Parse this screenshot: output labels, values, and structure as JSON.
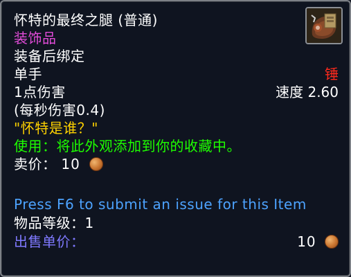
{
  "item": {
    "name": "怀特的最终之腿 (普通)",
    "type": "装饰品",
    "binding": "装备后绑定",
    "slot": "单手",
    "subtype": "锤",
    "damage": "1点伤害",
    "speed": "速度 2.60",
    "dps": "(每秒伤害0.4)",
    "flavor": "\"怀特是谁？\"",
    "use": "使用：将此外观添加到你的收藏中。",
    "sell": {
      "label": "卖价：",
      "amount": "10"
    },
    "press_f6": "Press F6 to submit an issue for this Item",
    "item_level": "物品等级：1",
    "unit_price": {
      "label": "出售单价：",
      "amount": "10"
    }
  },
  "colors": {
    "name": "#ffffff",
    "type": "#e14bd8",
    "white": "#ffffff",
    "red": "#ff2a1c",
    "flavor": "#ffd200",
    "use": "#1eff00",
    "blue": "#4da3ff",
    "coin": "copper-coin-icon"
  },
  "icon": {
    "name": "bag-of-meat-icon"
  }
}
